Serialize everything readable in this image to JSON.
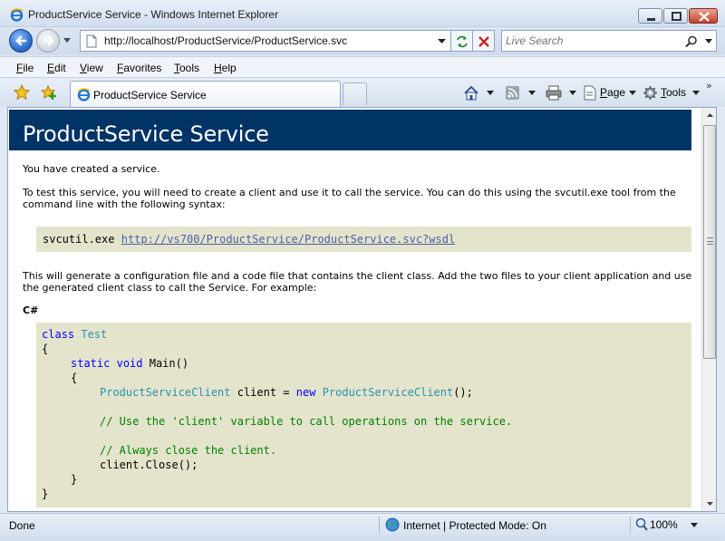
{
  "window": {
    "title": "ProductService Service - Windows Internet Explorer"
  },
  "address": {
    "url": "http://localhost/ProductService/ProductService.svc"
  },
  "search": {
    "placeholder": "Live Search"
  },
  "menu": {
    "items": [
      "File",
      "Edit",
      "View",
      "Favorites",
      "Tools",
      "Help"
    ]
  },
  "tabs": {
    "active_label": "ProductService Service"
  },
  "commands": {
    "page_label": "Page",
    "tools_label": "Tools",
    "overflow": "»"
  },
  "content": {
    "heading": "ProductService Service",
    "intro": "You have created a service.",
    "test_instructions": "To test this service, you will need to create a client and use it to call the service. You can do this using the svcutil.exe tool from the command line with the following syntax:",
    "svcutil_command": "svcutil.exe",
    "wsdl_link": "http://vs700/ProductService/ProductService.svc?wsdl",
    "generate_instructions": "This will generate a configuration file and a code file that contains the client class. Add the two files to your client application and use the generated client class to call the Service. For example:",
    "language_label": "C#",
    "code": {
      "kw_class": "class",
      "class_name": "Test",
      "open_brace": "{",
      "kw_static": "static",
      "kw_void": "void",
      "method": "Main()",
      "inner_open": "{",
      "client_type": "ProductServiceClient",
      "client_assign": "client =",
      "kw_new": "new",
      "ctor_type": "ProductServiceClient",
      "ctor_end": "();",
      "comment_use": "// Use the 'client' variable to call operations on the service.",
      "comment_close": "// Always close the client.",
      "close_call": "client.Close();",
      "inner_close": "}",
      "close_brace": "}"
    }
  },
  "status": {
    "text": "Done",
    "zone": "Internet | Protected Mode: On",
    "zoom": "100%"
  },
  "colors": {
    "heading_band": "#003366",
    "code_background": "#e4e4cc",
    "keyword": "#0000ff",
    "type": "#2b91af",
    "comment": "#008000",
    "link": "#4a5fa8"
  }
}
